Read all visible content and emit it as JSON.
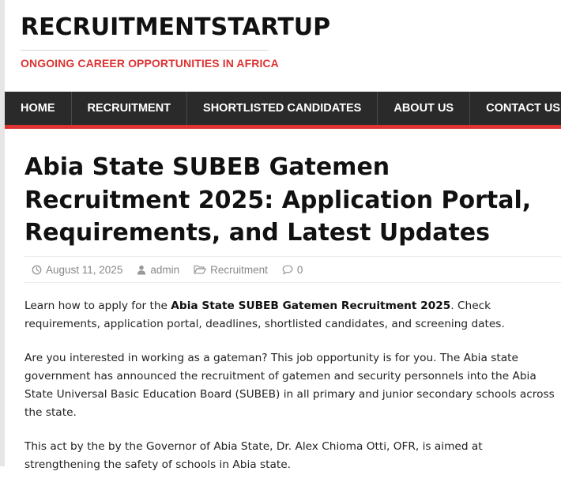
{
  "site": {
    "title": "RECRUITMENTSTARTUP",
    "tagline": "ONGOING CAREER OPPORTUNITIES IN AFRICA"
  },
  "nav": {
    "items": [
      {
        "label": "HOME"
      },
      {
        "label": "RECRUITMENT"
      },
      {
        "label": "SHORTLISTED CANDIDATES"
      },
      {
        "label": "ABOUT US"
      },
      {
        "label": "CONTACT US"
      }
    ]
  },
  "article": {
    "title": "Abia State SUBEB Gatemen Recruitment 2025: Application Portal, Requirements, and Latest Updates",
    "meta": {
      "date": "August 11, 2025",
      "author": "admin",
      "category": "Recruitment",
      "comments": "0"
    },
    "p1_before": "Learn how to apply for the ",
    "p1_bold": "Abia State SUBEB Gatemen Recruitment 2025",
    "p1_after": ". Check requirements, application portal, deadlines, shortlisted candidates, and screening dates.",
    "p2": "Are you interested in working as a gateman? This job opportunity is for you. The Abia state government has announced the recruitment of gatemen and security personnels into the Abia State Universal Basic Education Board (SUBEB)  in all primary and junior secondary schools across the state.",
    "p3": "This act by the by the Governor of Abia State, Dr. Alex Chioma Otti, OFR, is aimed at strengthening the safety of schools in Abia state."
  },
  "colors": {
    "accent": "#dd3333",
    "nav_bg": "#2a2a2a",
    "meta_text": "#888888"
  },
  "icons": {
    "date": "clock-icon",
    "author": "user-icon",
    "category": "folder-icon",
    "comments": "comment-icon"
  }
}
